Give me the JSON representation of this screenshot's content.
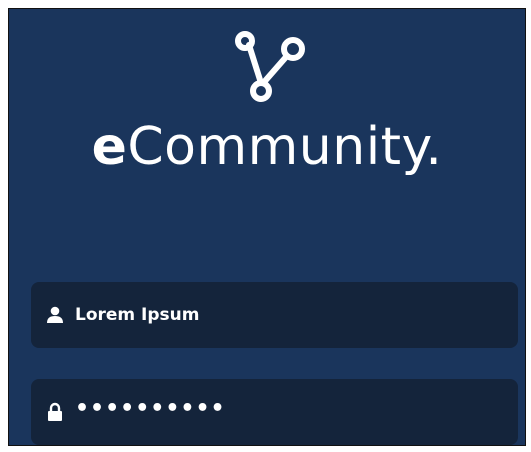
{
  "app": {
    "brand_first": "e",
    "brand_rest": "Community",
    "brand_dot": ".",
    "logo_icon": "connection-nodes-icon"
  },
  "login": {
    "username": {
      "icon": "user-icon",
      "value": "Lorem Ipsum"
    },
    "password": {
      "icon": "lock-icon",
      "value": "••••••••••"
    }
  },
  "colors": {
    "background": "#1a355c",
    "field_background": "#14243b",
    "text": "#ffffff"
  }
}
